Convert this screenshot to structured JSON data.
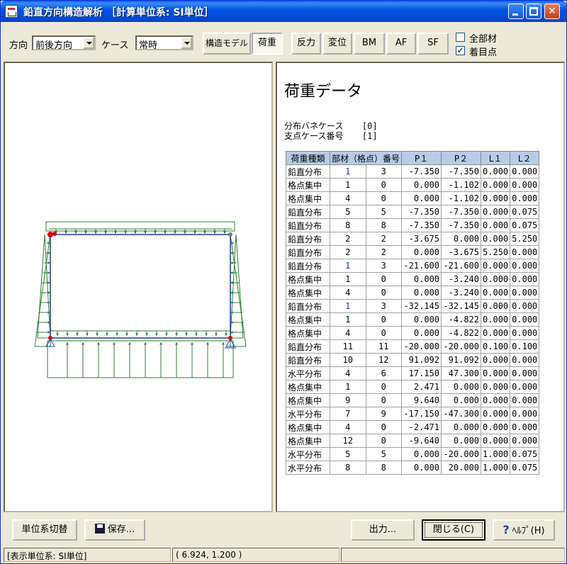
{
  "window": {
    "title": "鉛直方向構造解析 ［計算単位系: SI単位］"
  },
  "toolbar": {
    "direction_label": "方向",
    "direction_value": "前後方向",
    "case_label": "ケース",
    "case_value": "常時",
    "buttons": [
      "構造モデル",
      "荷重",
      "反力",
      "変位",
      "BM",
      "AF",
      "SF"
    ],
    "active_button": "荷重",
    "all_members_label": "全部材",
    "all_members_checked": false,
    "focus_point_label": "着目点",
    "focus_point_checked": true
  },
  "data_panel": {
    "title": "荷重データ",
    "spring_case_label": "分布バネケース",
    "spring_case_value": "[0]",
    "support_case_label": "支点ケース番号",
    "support_case_value": "[1]",
    "columns": [
      "荷重種類",
      "部材（格点）番号",
      "P１",
      "P２",
      "L１",
      "L２"
    ],
    "rows": [
      [
        "鉛直分布",
        "1",
        "3",
        "-7.350",
        "-7.350",
        "0.000",
        "0.000"
      ],
      [
        "格点集中",
        "1",
        "0",
        "0.000",
        "-1.102",
        "0.000",
        "0.000"
      ],
      [
        "格点集中",
        "4",
        "0",
        "0.000",
        "-1.102",
        "0.000",
        "0.000"
      ],
      [
        "鉛直分布",
        "5",
        "5",
        "-7.350",
        "-7.350",
        "0.000",
        "0.075"
      ],
      [
        "鉛直分布",
        "8",
        "8",
        "-7.350",
        "-7.350",
        "0.000",
        "0.075"
      ],
      [
        "鉛直分布",
        "2",
        "2",
        "-3.675",
        "0.000",
        "0.000",
        "5.250"
      ],
      [
        "鉛直分布",
        "2",
        "2",
        "0.000",
        "-3.675",
        "5.250",
        "0.000"
      ],
      [
        "鉛直分布",
        "1",
        "3",
        "-21.600",
        "-21.600",
        "0.000",
        "0.000"
      ],
      [
        "格点集中",
        "1",
        "0",
        "0.000",
        "-3.240",
        "0.000",
        "0.000"
      ],
      [
        "格点集中",
        "4",
        "0",
        "0.000",
        "-3.240",
        "0.000",
        "0.000"
      ],
      [
        "鉛直分布",
        "1",
        "3",
        "-32.145",
        "-32.145",
        "0.000",
        "0.000"
      ],
      [
        "格点集中",
        "1",
        "0",
        "0.000",
        "-4.822",
        "0.000",
        "0.000"
      ],
      [
        "格点集中",
        "4",
        "0",
        "0.000",
        "-4.822",
        "0.000",
        "0.000"
      ],
      [
        "鉛直分布",
        "11",
        "11",
        "-20.000",
        "-20.000",
        "0.100",
        "0.100"
      ],
      [
        "鉛直分布",
        "10",
        "12",
        "91.092",
        "91.092",
        "0.000",
        "0.000"
      ],
      [
        "水平分布",
        "4",
        "6",
        "17.150",
        "47.300",
        "0.000",
        "0.000"
      ],
      [
        "格点集中",
        "1",
        "0",
        "2.471",
        "0.000",
        "0.000",
        "0.000"
      ],
      [
        "格点集中",
        "9",
        "0",
        "9.640",
        "0.000",
        "0.000",
        "0.000"
      ],
      [
        "水平分布",
        "7",
        "9",
        "-17.150",
        "-47.300",
        "0.000",
        "0.000"
      ],
      [
        "格点集中",
        "4",
        "0",
        "-2.471",
        "0.000",
        "0.000",
        "0.000"
      ],
      [
        "格点集中",
        "12",
        "0",
        "-9.640",
        "0.000",
        "0.000",
        "0.000"
      ],
      [
        "水平分布",
        "5",
        "5",
        "0.000",
        "-20.000",
        "1.000",
        "0.075"
      ],
      [
        "水平分布",
        "8",
        "8",
        "0.000",
        "20.000",
        "1.000",
        "0.075"
      ]
    ]
  },
  "footer": {
    "unit_switch_label": "単位系切替",
    "save_label": "保存...",
    "output_label": "出力...",
    "close_label": "閉じる(C)",
    "help_label": "ﾍﾙﾌﾟ(H)"
  },
  "status": {
    "unit_text": "[表示単位系: SI単位]",
    "coordinates": "(    6.924,     1.200 )"
  },
  "colors": {
    "load_green": "#2e7d32",
    "frame_blue": "#1a3aa0",
    "node_red": "#dd0000",
    "header_blue": "#b8cce6"
  }
}
